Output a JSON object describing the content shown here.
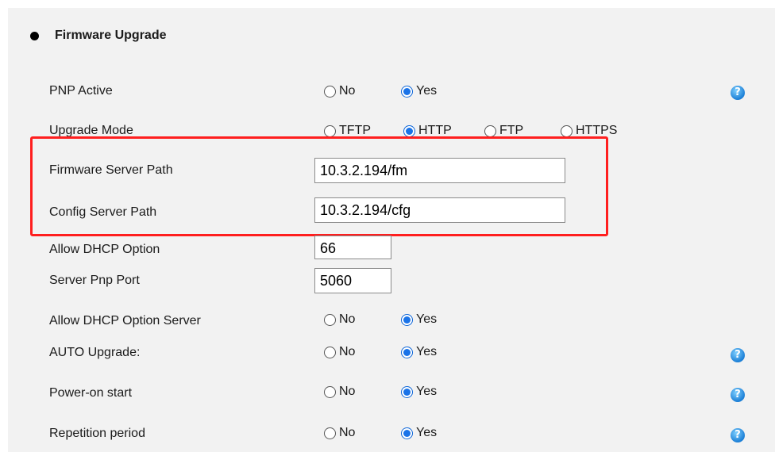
{
  "section": {
    "title": "Firmware Upgrade"
  },
  "pnp_active": {
    "label": "PNP Active",
    "options": [
      "No",
      "Yes"
    ],
    "selected": "Yes"
  },
  "upgrade_mode": {
    "label": "Upgrade Mode",
    "options": [
      "TFTP",
      "HTTP",
      "FTP",
      "HTTPS"
    ],
    "selected": "HTTP"
  },
  "firmware_server_path": {
    "label": "Firmware Server Path",
    "value": "10.3.2.194/fm"
  },
  "config_server_path": {
    "label": "Config Server Path",
    "value": "10.3.2.194/cfg"
  },
  "allow_dhcp_option": {
    "label": "Allow DHCP Option",
    "value": "66"
  },
  "server_pnp_port": {
    "label": "Server Pnp Port",
    "value": "5060"
  },
  "allow_dhcp_option_server": {
    "label": "Allow DHCP Option Server",
    "options": [
      "No",
      "Yes"
    ],
    "selected": "Yes"
  },
  "auto_upgrade": {
    "label": "AUTO Upgrade:",
    "options": [
      "No",
      "Yes"
    ],
    "selected": "Yes"
  },
  "power_on_start": {
    "label": "Power-on start",
    "options": [
      "No",
      "Yes"
    ],
    "selected": "Yes"
  },
  "repetition_period": {
    "label": "Repetition period",
    "options": [
      "No",
      "Yes"
    ],
    "selected": "Yes"
  },
  "help_glyph": "?",
  "colors": {
    "highlight": "#ff1f1f",
    "radio_selected": "#1a73e8",
    "help_icon": "#1c7fd6"
  }
}
